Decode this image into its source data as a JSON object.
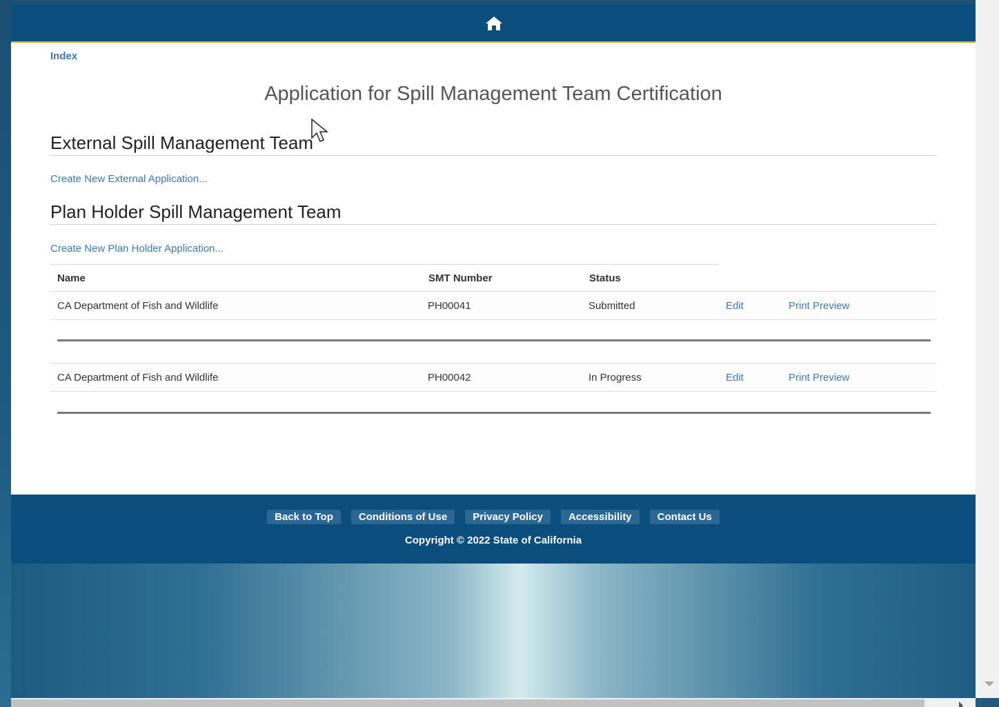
{
  "breadcrumb": "Index",
  "page_title": "Application for Spill Management Team Certification",
  "external_section": {
    "heading": "External Spill Management Team",
    "create_link": "Create New External Application..."
  },
  "planholder_section": {
    "heading": "Plan Holder Spill Management Team",
    "create_link": "Create New Plan Holder Application...",
    "columns": [
      "Name",
      "SMT Number",
      "Status"
    ],
    "rows": [
      {
        "name": "CA Department of Fish and Wildlife",
        "smt": "PH00041",
        "status": "Submitted",
        "edit": "Edit",
        "preview": "Print Preview"
      },
      {
        "name": "CA Department of Fish and Wildlife",
        "smt": "PH00042",
        "status": "In Progress",
        "edit": "Edit",
        "preview": "Print Preview"
      }
    ]
  },
  "footer": {
    "links": [
      "Back to Top",
      "Conditions of Use",
      "Privacy Policy",
      "Accessibility",
      "Contact Us"
    ],
    "copyright": "Copyright © 2022 State of California"
  },
  "icons": {
    "home": "home-icon"
  },
  "colors": {
    "header_bg": "#0b4d7c",
    "accent": "#e8a93b",
    "link": "#3f77b0"
  }
}
